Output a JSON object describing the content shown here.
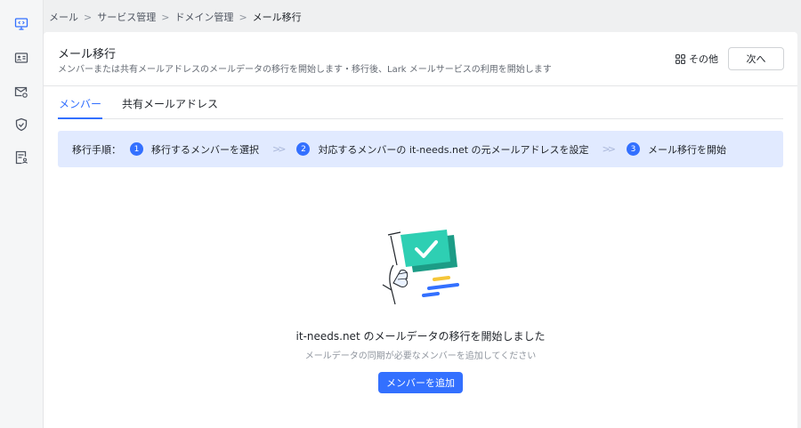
{
  "breadcrumb": {
    "items": [
      "メール",
      "サービス管理",
      "ドメイン管理",
      "メール移行"
    ],
    "separator": ">"
  },
  "sidebar": {
    "icons": [
      "monitor-code-icon",
      "id-card-icon",
      "mail-settings-icon",
      "shield-check-icon",
      "document-user-icon"
    ]
  },
  "header": {
    "title": "メール移行",
    "subtitle": "メンバーまたは共有メールアドレスのメールデータの移行を開始します・移行後、Lark メールサービスの利用を開始します",
    "more_label": "その他",
    "next_label": "次へ"
  },
  "tabs": [
    {
      "label": "メンバー",
      "active": true
    },
    {
      "label": "共有メールアドレス",
      "active": false
    }
  ],
  "steps": {
    "lead": "移行手順：",
    "items": [
      {
        "num": "1",
        "label": "移行するメンバーを選択"
      },
      {
        "num": "2",
        "label": "対応するメンバーの it-needs.net の元メールアドレスを設定"
      },
      {
        "num": "3",
        "label": "メール移行を開始"
      }
    ],
    "separator": ">>"
  },
  "empty_state": {
    "title": "it-needs.net のメールデータの移行を開始しました",
    "subtitle": "メールデータの同期が必要なメンバーを追加してください",
    "button_label": "メンバーを追加"
  },
  "colors": {
    "accent": "#3370ff",
    "steps_bg": "#e1eaff",
    "illustration_teal": "#2ecfb3",
    "illustration_yellow": "#f5c638"
  }
}
